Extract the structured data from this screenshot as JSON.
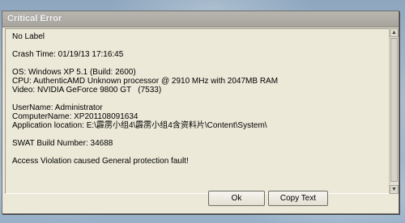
{
  "window": {
    "title": "Critical Error"
  },
  "report": {
    "label_line": "No Label",
    "crash_time": "Crash Time: 01/19/13 17:16:45",
    "os": "OS: Windows XP 5.1 (Build: 2600)",
    "cpu": "CPU: AuthenticAMD Unknown processor @ 2910 MHz with 2047MB RAM",
    "video": "Video: NVIDIA GeForce 9800 GT   (7533)",
    "username": "UserName: Administrator",
    "computername": "ComputerName: XP201108091634",
    "app_location": "Application location: E:\\霹雳小组4\\霹雳小组4含资料片\\Content\\System\\",
    "swat_build": "SWAT Build Number: 34688",
    "error": "Access Violation caused General protection fault!"
  },
  "buttons": {
    "ok": "Ok",
    "copy_text": "Copy Text"
  },
  "scrollbar": {
    "up_icon": "arrow-up-icon",
    "down_icon": "arrow-down-icon"
  }
}
